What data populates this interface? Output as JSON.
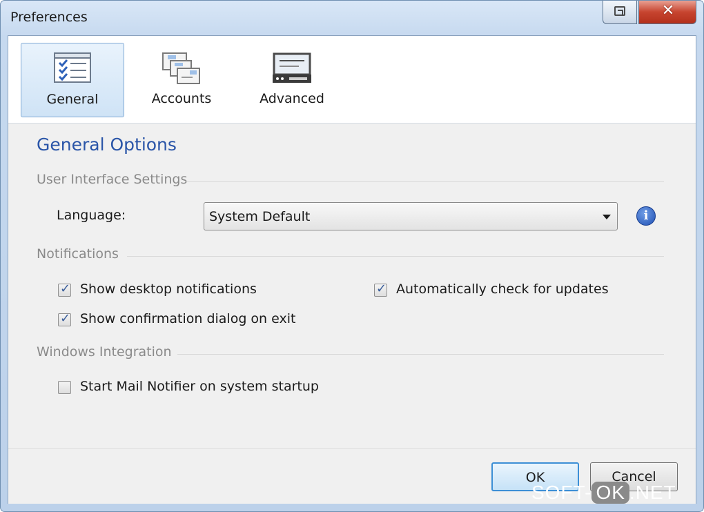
{
  "window": {
    "title": "Preferences",
    "close_glyph": "✕"
  },
  "toolbar": {
    "tabs": [
      {
        "label": "General",
        "icon": "checklist-icon",
        "selected": true
      },
      {
        "label": "Accounts",
        "icon": "envelopes-icon",
        "selected": false
      },
      {
        "label": "Advanced",
        "icon": "device-icon",
        "selected": false
      }
    ]
  },
  "content": {
    "heading": "General Options",
    "ui_section": {
      "title": "User Interface Settings",
      "language_label": "Language:",
      "language_value": "System Default"
    },
    "notifications": {
      "title": "Notifications",
      "items": [
        {
          "label": "Show desktop notifications",
          "checked": true
        },
        {
          "label": "Automatically check for updates",
          "checked": true
        },
        {
          "label": "Show confirmation dialog on exit",
          "checked": true
        }
      ]
    },
    "integration": {
      "title": "Windows Integration",
      "items": [
        {
          "label": "Start Mail Notifier on system startup",
          "checked": false
        }
      ]
    }
  },
  "footer": {
    "ok_label": "OK",
    "cancel_label": "Cancel"
  },
  "watermark": {
    "left": "SOFT-",
    "mid": "OK",
    "right": ".NET"
  },
  "colors": {
    "heading": "#2a55a8",
    "accent": "#3c8fd6",
    "close": "#c7442f"
  }
}
